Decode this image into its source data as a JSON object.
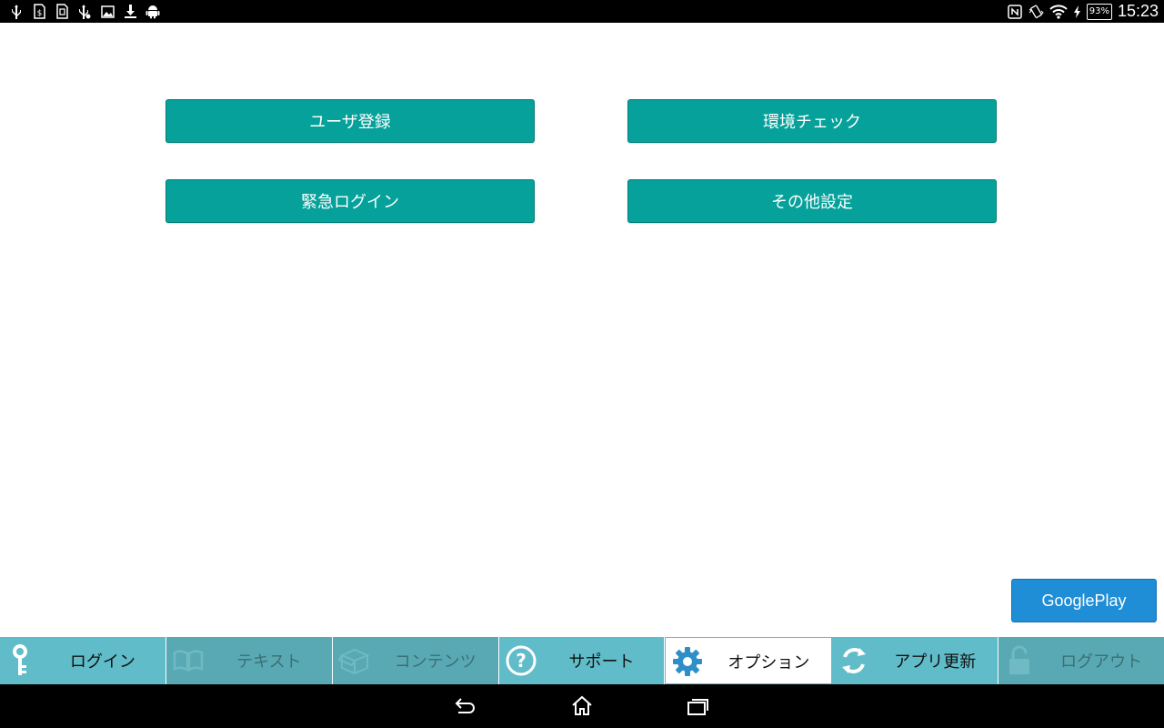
{
  "status_bar": {
    "time": "15:23",
    "battery": "93%",
    "left_icons": [
      "usb-icon",
      "sim-icon",
      "sim-card-icon",
      "usb-debug-icon",
      "image-icon",
      "download-icon",
      "android-icon"
    ],
    "right_icons": [
      "nfc-icon",
      "vibrate-icon",
      "wifi-icon",
      "charging-icon"
    ]
  },
  "options": {
    "user_register": "ユーザ登録",
    "env_check": "環境チェック",
    "emergency_login": "緊急ログイン",
    "other_settings": "その他設定"
  },
  "googleplay_label": "GooglePlay",
  "tabs": [
    {
      "label": "ログイン",
      "icon": "key-icon",
      "state": "normal"
    },
    {
      "label": "テキスト",
      "icon": "book-icon",
      "state": "disabled"
    },
    {
      "label": "コンテンツ",
      "icon": "box-icon",
      "state": "disabled"
    },
    {
      "label": "サポート",
      "icon": "question-icon",
      "state": "normal"
    },
    {
      "label": "オプション",
      "icon": "gear-icon",
      "state": "active"
    },
    {
      "label": "アプリ更新",
      "icon": "refresh-icon",
      "state": "normal"
    },
    {
      "label": "ログアウト",
      "icon": "unlock-icon",
      "state": "disabled"
    }
  ],
  "colors": {
    "option_button": "#05a19a",
    "googleplay_button": "#1f8ed6",
    "tab_bar": "#60bcc8",
    "tab_active": "#ffffff"
  },
  "nav": [
    "back-icon",
    "home-icon",
    "recent-apps-icon"
  ]
}
